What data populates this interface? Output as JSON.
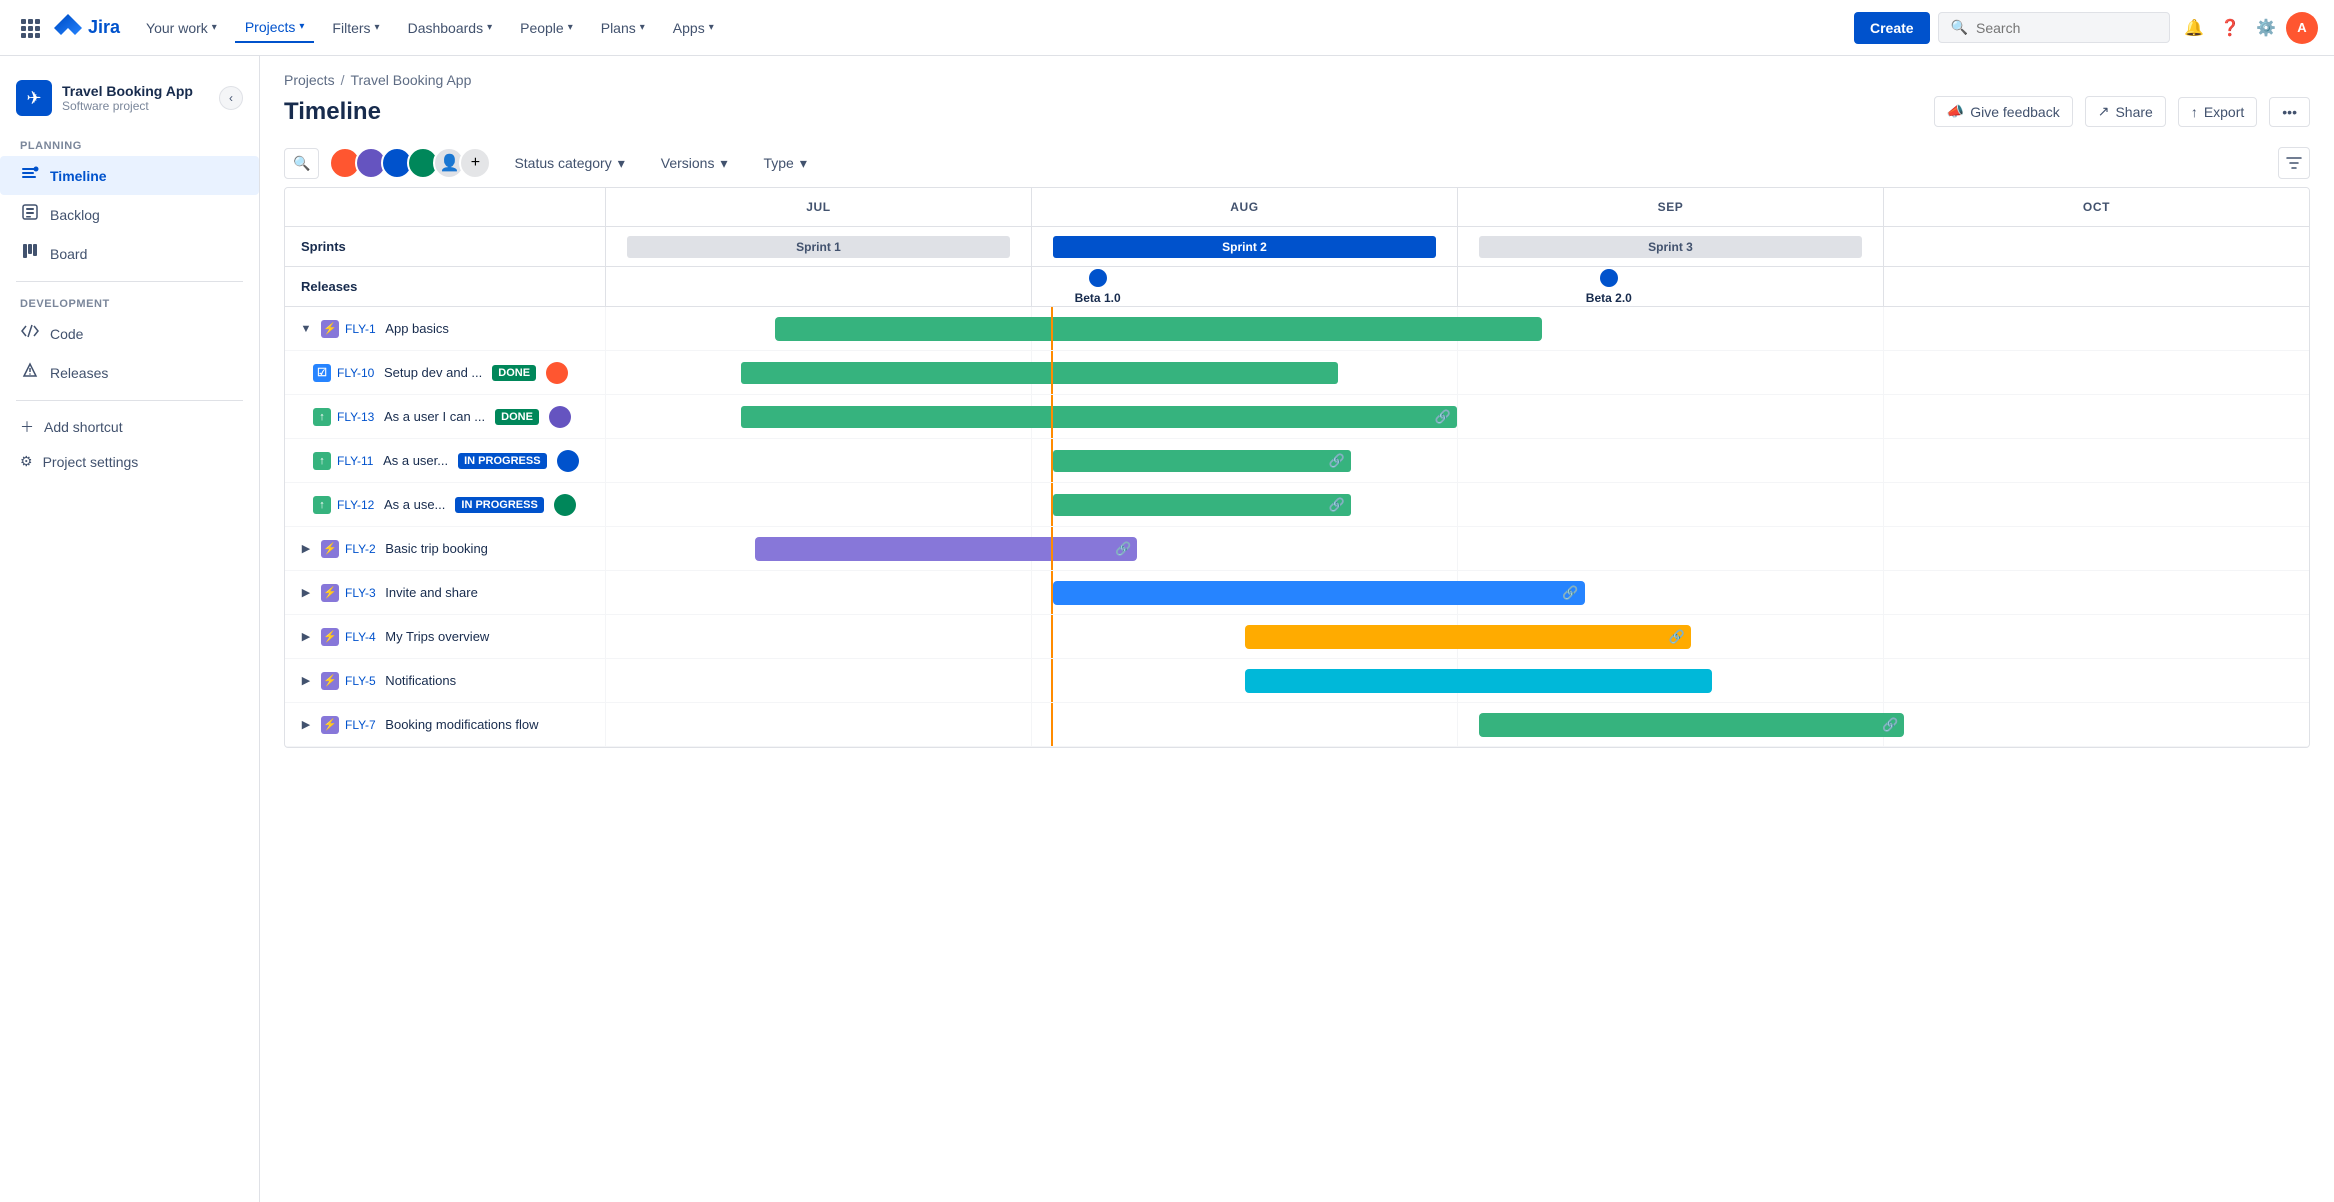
{
  "topnav": {
    "logo_text": "Jira",
    "your_work": "Your work",
    "projects": "Projects",
    "filters": "Filters",
    "dashboards": "Dashboards",
    "people": "People",
    "plans": "Plans",
    "apps": "Apps",
    "create": "Create",
    "search_placeholder": "Search"
  },
  "sidebar": {
    "project_name": "Travel Booking App",
    "project_type": "Software project",
    "planning_label": "PLANNING",
    "timeline": "Timeline",
    "backlog": "Backlog",
    "board": "Board",
    "development_label": "DEVELOPMENT",
    "code": "Code",
    "releases": "Releases",
    "add_shortcut": "Add shortcut",
    "project_settings": "Project settings"
  },
  "page": {
    "breadcrumb_projects": "Projects",
    "breadcrumb_app": "Travel Booking App",
    "title": "Timeline",
    "give_feedback": "Give feedback",
    "share": "Share",
    "export": "Export"
  },
  "filters": {
    "status_category": "Status category",
    "versions": "Versions",
    "type": "Type"
  },
  "timeline": {
    "months": [
      "JUL",
      "AUG",
      "SEP",
      "OCT"
    ],
    "sprints_label": "Sprints",
    "releases_label": "Releases",
    "sprint1": "Sprint 1",
    "sprint2": "Sprint 2",
    "sprint3": "Sprint 3",
    "beta1": "Beta 1.0",
    "beta2": "Beta 2.0"
  },
  "issues": [
    {
      "key": "FLY-1",
      "title": "App basics",
      "type": "epic",
      "expanded": true,
      "indent": 0
    },
    {
      "key": "FLY-10",
      "title": "Setup dev and ...",
      "type": "story",
      "status": "DONE",
      "indent": 1
    },
    {
      "key": "FLY-13",
      "title": "As a user I can ...",
      "type": "story",
      "status": "DONE",
      "indent": 1
    },
    {
      "key": "FLY-11",
      "title": "As a user...",
      "type": "story",
      "status": "IN PROGRESS",
      "indent": 1
    },
    {
      "key": "FLY-12",
      "title": "As a use...",
      "type": "story",
      "status": "IN PROGRESS",
      "indent": 1
    },
    {
      "key": "FLY-2",
      "title": "Basic trip booking",
      "type": "epic",
      "expanded": false,
      "indent": 0
    },
    {
      "key": "FLY-3",
      "title": "Invite and share",
      "type": "epic",
      "expanded": false,
      "indent": 0
    },
    {
      "key": "FLY-4",
      "title": "My Trips overview",
      "type": "epic",
      "expanded": false,
      "indent": 0
    },
    {
      "key": "FLY-5",
      "title": "Notifications",
      "type": "epic",
      "expanded": false,
      "indent": 0
    },
    {
      "key": "FLY-7",
      "title": "Booking modifications flow",
      "type": "epic",
      "expanded": false,
      "indent": 0
    }
  ]
}
